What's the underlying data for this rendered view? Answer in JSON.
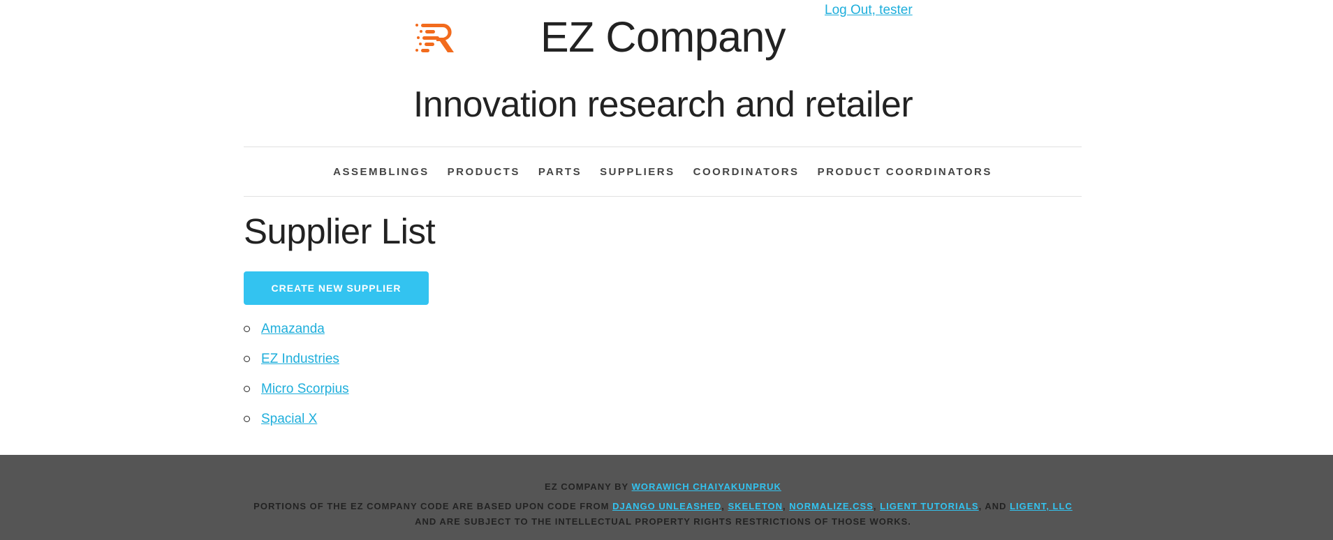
{
  "header": {
    "logout_label": "Log Out, tester",
    "company_name": "EZ Company",
    "tagline": "Innovation research and retailer",
    "logo_icon": "logo-icon",
    "logo_color": "#F26B1D"
  },
  "nav": {
    "items": [
      {
        "label": "ASSEMBLINGS"
      },
      {
        "label": "PRODUCTS"
      },
      {
        "label": "PARTS"
      },
      {
        "label": "SUPPLIERS"
      },
      {
        "label": "COORDINATORS"
      },
      {
        "label": "PRODUCT COORDINATORS"
      }
    ]
  },
  "main": {
    "title": "Supplier List",
    "create_button_label": "CREATE NEW SUPPLIER",
    "suppliers": [
      {
        "name": "Amazanda"
      },
      {
        "name": "EZ Industries"
      },
      {
        "name": "Micro Scorpius"
      },
      {
        "name": "Spacial X"
      }
    ]
  },
  "footer": {
    "line1_prefix": "EZ COMPANY BY ",
    "author_link": "WORAWICH CHAIYAKUNPRUK",
    "line2_prefix": "PORTIONS OF THE EZ COMPANY CODE ARE BASED UPON CODE FROM ",
    "link_django": "DJANGO UNLEASHED",
    "sep1": ", ",
    "link_skeleton": "SKELETON",
    "sep2": ", ",
    "link_normalize": "NORMALIZE.CSS",
    "sep3": ", ",
    "link_ligent_tutorials": "LIGENT TUTORIALS",
    "sep4": ", AND ",
    "link_ligent_llc": "LIGENT, LLC",
    "line3": "AND ARE SUBJECT TO THE INTELLECTUAL PROPERTY RIGHTS RESTRICTIONS OF THOSE WORKS."
  },
  "colors": {
    "accent": "#33C3F0",
    "link": "#1EAEDB",
    "footer_bg": "#555555"
  }
}
